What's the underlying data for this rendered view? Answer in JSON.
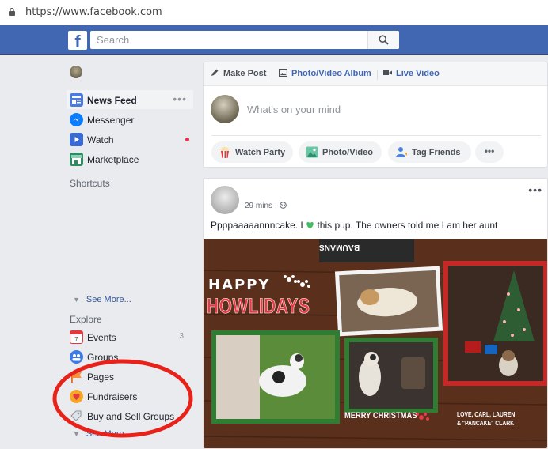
{
  "browser": {
    "url": "https://www.facebook.com"
  },
  "topbar": {
    "logo": "f",
    "search_placeholder": "Search"
  },
  "sidebar": {
    "items": [
      {
        "label": "News Feed",
        "more": "•••"
      },
      {
        "label": "Messenger"
      },
      {
        "label": "Watch"
      },
      {
        "label": "Marketplace"
      }
    ],
    "shortcuts_label": "Shortcuts",
    "see_more_1": "See More...",
    "explore_label": "Explore",
    "explore_items": [
      {
        "label": "Events",
        "count": "3"
      },
      {
        "label": "Groups"
      },
      {
        "label": "Pages"
      },
      {
        "label": "Fundraisers"
      },
      {
        "label": "Buy and Sell Groups"
      }
    ],
    "see_more_2": "See More..."
  },
  "composer": {
    "tabs": [
      "Make Post",
      "Photo/Video Album",
      "Live Video"
    ],
    "placeholder": "What's on your mind",
    "actions": [
      "Watch Party",
      "Photo/Video",
      "Tag Friends"
    ],
    "more": "•••"
  },
  "post": {
    "time": "29 mins · ",
    "text_before": "Ppppaaaaannncake. I ",
    "text_after": " this pup. The owners told me I am her aunt",
    "more": "•••",
    "card": {
      "banner": "BAUMANS",
      "happy": "HAPPY",
      "title": "HOWLIDAYS",
      "merry": "MERRY CHRISTMAS",
      "sign_line1": "LOVE, CARL, LAUREN",
      "sign_line2": "& \"PANCAKE\" CLARK"
    }
  },
  "colors": {
    "facebook_blue": "#4267b2",
    "annotation_red": "#e8211a",
    "link_blue": "#365899",
    "background": "#e9ebee"
  }
}
